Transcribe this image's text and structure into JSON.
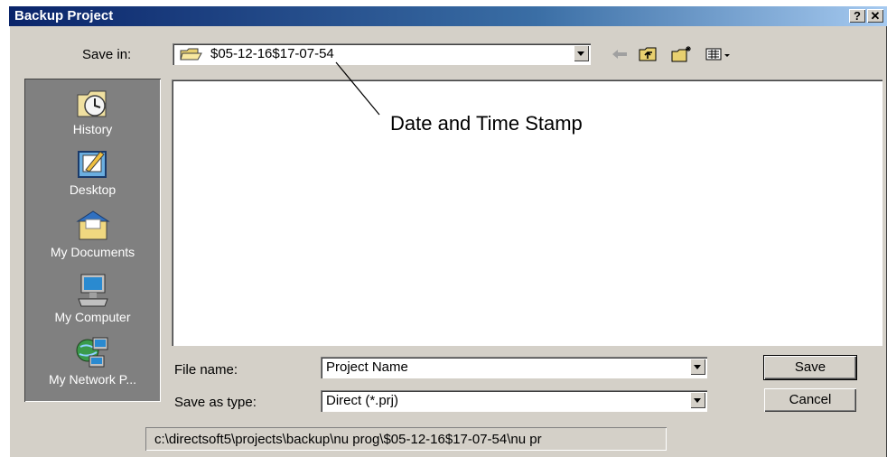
{
  "window": {
    "title": "Backup Project",
    "help_label": "?",
    "close_label": "✕"
  },
  "save_in": {
    "label": "Save in:",
    "value": "$05-12-16$17-07-54"
  },
  "toolbar": {
    "back_icon": "back-arrow-icon",
    "up_icon": "up-folder-icon",
    "new_folder_icon": "new-folder-icon",
    "views_icon": "views-menu-icon"
  },
  "places": [
    {
      "label": "History",
      "icon": "history-icon"
    },
    {
      "label": "Desktop",
      "icon": "desktop-icon"
    },
    {
      "label": "My Documents",
      "icon": "my-documents-icon"
    },
    {
      "label": "My Computer",
      "icon": "my-computer-icon"
    },
    {
      "label": "My Network P...",
      "icon": "my-network-places-icon"
    }
  ],
  "annotation": "Date and Time Stamp",
  "file_name": {
    "label": "File name:",
    "value": "Project Name"
  },
  "save_as_type": {
    "label": "Save as type:",
    "value": "Direct (*.prj)"
  },
  "buttons": {
    "save": "Save",
    "cancel": "Cancel"
  },
  "path": "c:\\directsoft5\\projects\\backup\\nu prog\\$05-12-16$17-07-54\\nu pr"
}
